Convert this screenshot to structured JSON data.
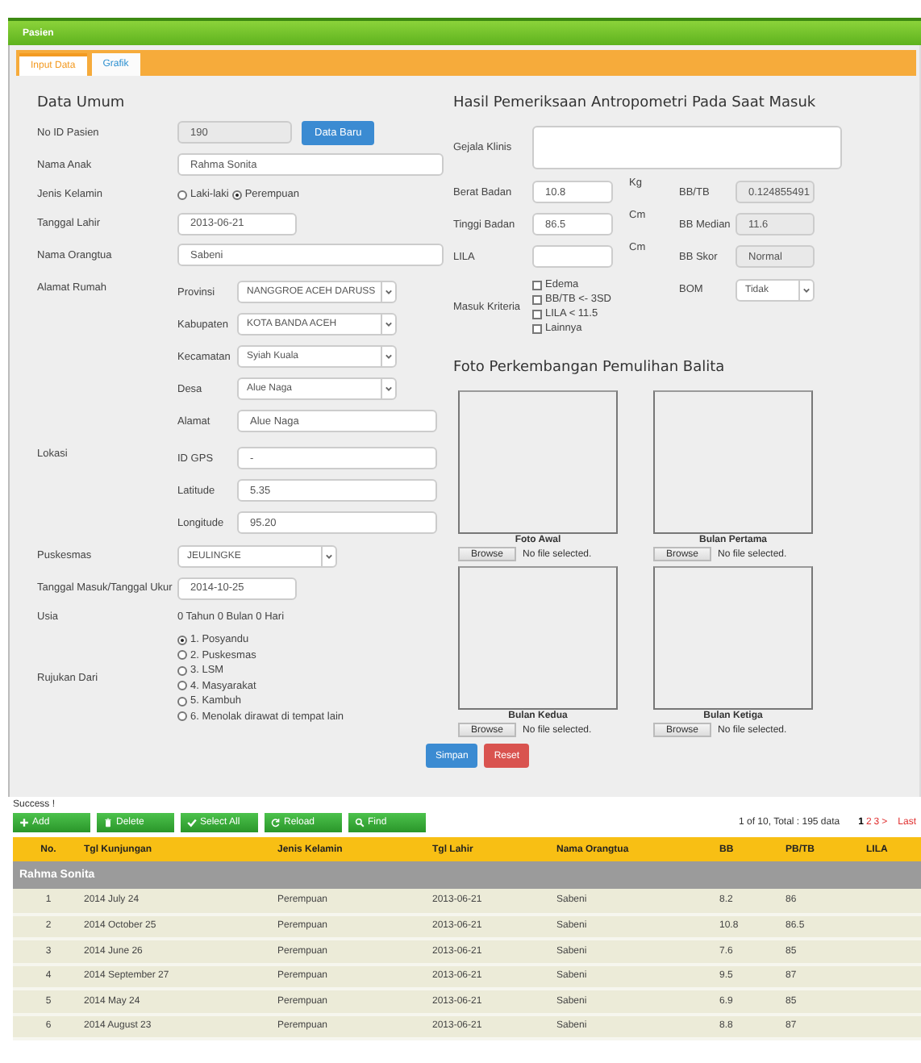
{
  "panel_title": "Pasien",
  "tabs": [
    {
      "label": "Input Data",
      "selected": true
    },
    {
      "label": "Grafik",
      "selected": false
    }
  ],
  "general": {
    "heading": "Data Umum",
    "fields": [
      {
        "kind": "id",
        "label": "No ID Pasien",
        "value": "190",
        "button": "Data Baru"
      },
      {
        "kind": "text",
        "label": "Nama Anak",
        "value": "Rahma Sonita"
      },
      {
        "kind": "radio",
        "label": "Jenis Kelamin",
        "options": [
          {
            "label": "Laki-laki",
            "selected": false
          },
          {
            "label": "Perempuan",
            "selected": true
          }
        ]
      },
      {
        "kind": "date",
        "label": "Tanggal Lahir",
        "value": "2013-06-21"
      },
      {
        "kind": "text",
        "label": "Nama Orangtua",
        "value": "Sabeni"
      },
      {
        "kind": "group",
        "label": "Alamat Rumah",
        "items": [
          {
            "kind": "select",
            "label": "Provinsi",
            "value": "NANGGROE ACEH DARUSS"
          },
          {
            "kind": "select",
            "label": "Kabupaten",
            "value": "KOTA BANDA ACEH"
          },
          {
            "kind": "select",
            "label": "Kecamatan",
            "value": "Syiah Kuala"
          },
          {
            "kind": "select",
            "label": "Desa",
            "value": "Alue Naga"
          },
          {
            "kind": "text",
            "label": "Alamat",
            "value": "Alue Naga"
          }
        ]
      },
      {
        "kind": "group",
        "label": "Lokasi",
        "items": [
          {
            "kind": "text",
            "label": "ID GPS",
            "value": "-"
          },
          {
            "kind": "text",
            "label": "Latitude",
            "value": "5.35"
          },
          {
            "kind": "text",
            "label": "Longitude",
            "value": "95.20"
          }
        ]
      },
      {
        "kind": "select",
        "label": "Puskesmas",
        "value": "JEULINGKE"
      },
      {
        "kind": "date",
        "label": "Tanggal Masuk/Tanggal Ukur",
        "value": "2014-10-25"
      },
      {
        "kind": "static",
        "label": "Usia",
        "value": "0 Tahun 0 Bulan 0 Hari"
      },
      {
        "kind": "radiolist",
        "label": "Rujukan Dari",
        "options": [
          {
            "label": "1. Posyandu",
            "selected": true
          },
          {
            "label": "2. Puskesmas",
            "selected": false
          },
          {
            "label": "3. LSM",
            "selected": false
          },
          {
            "label": "4. Masyarakat",
            "selected": false
          },
          {
            "label": "5. Kambuh",
            "selected": false
          },
          {
            "label": "6. Menolak dirawat di tempat lain",
            "selected": false
          }
        ]
      }
    ]
  },
  "exam": {
    "heading": "Hasil Pemeriksaan Antropometri Pada Saat Masuk",
    "symptoms_label": "Gejala Klinis",
    "measures": [
      {
        "label": "Berat Badan",
        "value": "10.8",
        "unit": "Kg",
        "result_label": "BB/TB",
        "result": "0.124855491"
      },
      {
        "label": "Tinggi Badan",
        "value": "86.5",
        "unit": "Cm",
        "result_label": "BB Median",
        "result": "11.6"
      },
      {
        "label": "LILA",
        "unit": "Cm",
        "result_label": "BB Skor",
        "result": "Normal"
      }
    ],
    "criteria": {
      "label": "Masuk Kriteria",
      "options": [
        {
          "label": "Edema",
          "checked": false
        },
        {
          "label": "BB/TB <- 3SD",
          "checked": false
        },
        {
          "label": "LILA < 11.5",
          "checked": false
        },
        {
          "label": "Lainnya",
          "checked": false
        }
      ]
    },
    "bom": {
      "label": "BOM",
      "value": "Tidak"
    }
  },
  "photos": {
    "heading": "Foto Perkembangan Pemulihan Balita",
    "items": [
      {
        "caption": "Foto Awal",
        "button": "Browse",
        "status": "No file selected."
      },
      {
        "caption": "Bulan Pertama",
        "button": "Browse",
        "status": "No file selected."
      },
      {
        "caption": "Bulan Kedua",
        "button": "Browse",
        "status": "No file selected."
      },
      {
        "caption": "Bulan Ketiga",
        "button": "Browse",
        "status": "No file selected."
      }
    ]
  },
  "actions": [
    {
      "label": "Simpan",
      "kind": "primary"
    },
    {
      "label": "Reset",
      "kind": "danger"
    }
  ],
  "message": "Success !",
  "toolbar": [
    {
      "label": "Add",
      "kind": "plus"
    },
    {
      "label": "Delete",
      "kind": "trash"
    },
    {
      "label": "Select All",
      "kind": "check"
    },
    {
      "label": "Reload",
      "kind": "refresh"
    },
    {
      "label": "Find",
      "kind": "search"
    }
  ],
  "pager": {
    "summary": "1 of 10, Total : 195 data",
    "pages": [
      {
        "label": "1",
        "selected": true
      },
      {
        "label": "2",
        "selected": false
      },
      {
        "label": "3",
        "selected": false
      }
    ],
    "next": ">",
    "last": "Last"
  },
  "table": {
    "columns": [
      "No.",
      "Tgl Kunjungan",
      "Jenis Kelamin",
      "Tgl Lahir",
      "Nama Orangtua",
      "BB",
      "PB/TB",
      "LILA"
    ],
    "group": "Rahma Sonita",
    "rows": [
      [
        "1",
        "2014 July 24",
        "Perempuan",
        "2013-06-21",
        "Sabeni",
        "8.2",
        "86"
      ],
      [
        "2",
        "2014 October 25",
        "Perempuan",
        "2013-06-21",
        "Sabeni",
        "10.8",
        "86.5"
      ],
      [
        "3",
        "2014 June 26",
        "Perempuan",
        "2013-06-21",
        "Sabeni",
        "7.6",
        "85"
      ],
      [
        "4",
        "2014 September 27",
        "Perempuan",
        "2013-06-21",
        "Sabeni",
        "9.5",
        "87"
      ],
      [
        "5",
        "2014 May 24",
        "Perempuan",
        "2013-06-21",
        "Sabeni",
        "6.9",
        "85"
      ],
      [
        "6",
        "2014 August 23",
        "Perempuan",
        "2013-06-21",
        "Sabeni",
        "8.8",
        "87"
      ]
    ]
  }
}
